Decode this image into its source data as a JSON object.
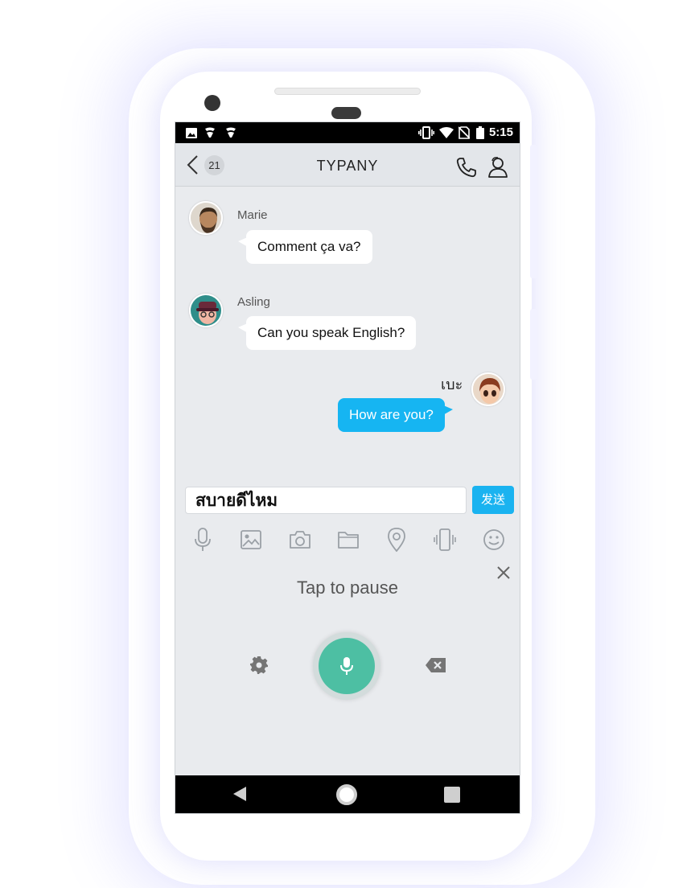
{
  "status_bar": {
    "time": "5:15",
    "left_icons": [
      "image-notification-icon",
      "shield-notification-icon",
      "shield-notification-icon"
    ],
    "right_icons": [
      "vibrate-icon",
      "wifi-icon",
      "no-sim-icon",
      "battery-icon"
    ]
  },
  "header": {
    "title": "TYPANY",
    "unread_count": "21",
    "actions": [
      "phone-icon",
      "contacts-icon"
    ]
  },
  "messages": [
    {
      "sender": "Marie",
      "text": "Comment ça va?",
      "direction": "incoming"
    },
    {
      "sender": "Asling",
      "text": "Can you speak English?",
      "direction": "incoming"
    },
    {
      "sender": "เบะ",
      "text": "How are you?",
      "direction": "outgoing"
    }
  ],
  "composer": {
    "input_value": "สบายดีไหม",
    "send_label": "发送"
  },
  "toolbar": {
    "tools": [
      "microphone-icon",
      "image-icon",
      "camera-icon",
      "folder-icon",
      "location-icon",
      "shake-icon",
      "emoji-icon"
    ]
  },
  "voice_panel": {
    "status_text": "Tap to pause"
  },
  "colors": {
    "accent": "#16b5f2",
    "mic_button": "#4dbfa3",
    "screen_bg": "#e9ebee"
  }
}
